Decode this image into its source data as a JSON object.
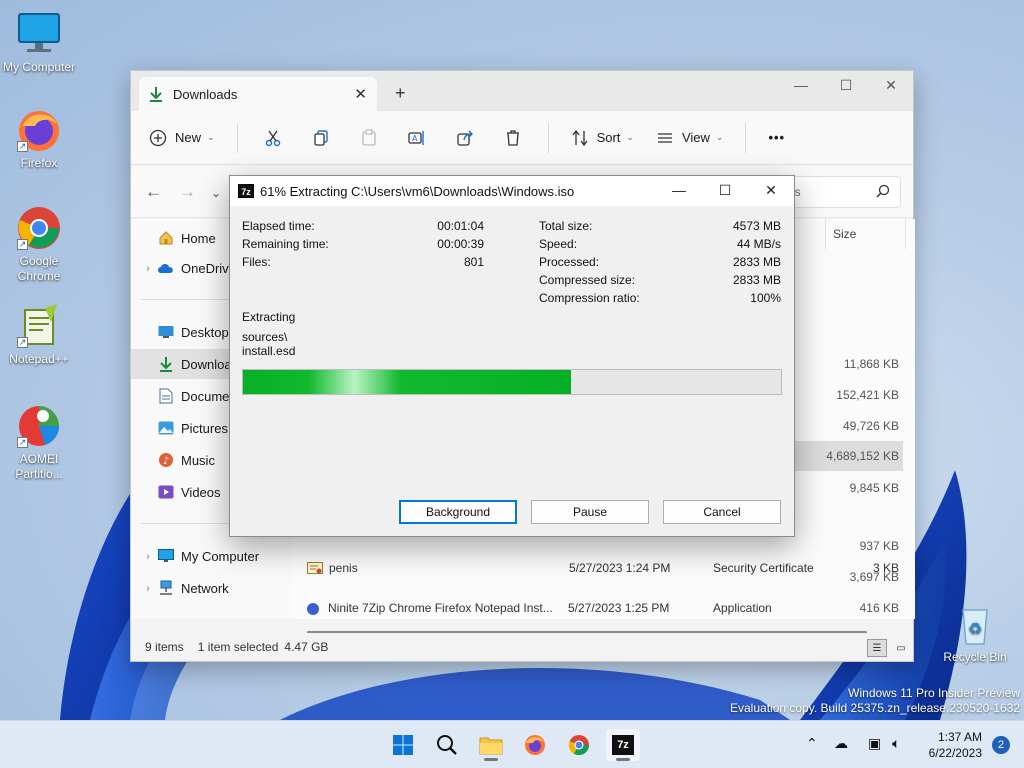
{
  "desktop": {
    "icons": [
      {
        "label": "My Computer"
      },
      {
        "label": "Firefox"
      },
      {
        "label": "Google Chrome"
      },
      {
        "label": "Notepad++"
      },
      {
        "label": "AOMEI Partitio..."
      },
      {
        "label": "Recycle Bin"
      }
    ],
    "watermark_line1": "Windows 11 Pro Insider Preview",
    "watermark_line2": "Evaluation copy. Build 25375.zn_release.230520-1632"
  },
  "explorer": {
    "tab_title": "Downloads",
    "toolbar": {
      "new_label": "New",
      "sort_label": "Sort",
      "view_label": "View",
      "more_label": "•••"
    },
    "search_placeholder": "ds",
    "nav": {
      "home": "Home",
      "onedrive": "OneDrive",
      "desktop": "Desktop",
      "downloads": "Downloads",
      "documents": "Documents",
      "pictures": "Pictures",
      "music": "Music",
      "videos": "Videos",
      "my_computer": "My Computer",
      "network": "Network"
    },
    "columns": {
      "size": "Size"
    },
    "sizes": [
      "11,868 KB",
      "152,421 KB",
      "49,726 KB",
      "4,689,152 KB",
      "9,845 KB",
      "937 KB",
      "3,697 KB",
      "416 KB",
      "3 KB"
    ],
    "partial_row": {
      "name": "Ninite 7Zip Chrome Firefox Notepad Inst...",
      "date": "5/27/2023 1:25 PM",
      "type": "Application"
    },
    "last_row": {
      "name": "penis",
      "date": "5/27/2023 1:24 PM",
      "type": "Security Certificate"
    },
    "status": {
      "items": "9 items",
      "selected": "1 item selected",
      "size": "4.47 GB"
    }
  },
  "dialog": {
    "title": "61% Extracting C:\\Users\\vm6\\Downloads\\Windows.iso",
    "progress_percent": 61,
    "left_stats": [
      {
        "label": "Elapsed time:",
        "value": "00:01:04"
      },
      {
        "label": "Remaining time:",
        "value": "00:00:39"
      },
      {
        "label": "Files:",
        "value": "801"
      }
    ],
    "right_stats": [
      {
        "label": "Total size:",
        "value": "4573 MB"
      },
      {
        "label": "Speed:",
        "value": "44 MB/s"
      },
      {
        "label": "Processed:",
        "value": "2833 MB"
      },
      {
        "label": "Compressed size:",
        "value": "2833 MB"
      },
      {
        "label": "Compression ratio:",
        "value": "100%"
      }
    ],
    "operation": "Extracting",
    "current_path_line1": "sources\\",
    "current_path_line2": "install.esd",
    "buttons": {
      "background": "Background",
      "pause": "Pause",
      "cancel": "Cancel"
    }
  },
  "taskbar": {
    "time": "1:37 AM",
    "date": "6/22/2023",
    "notification_count": "2"
  },
  "colors": {
    "progress_green": "#06b025",
    "accent": "#0078d4",
    "taskbar": "#dfe9f5"
  }
}
